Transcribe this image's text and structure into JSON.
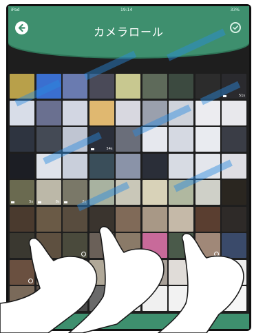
{
  "status": {
    "device": "iPad",
    "time": "19:14",
    "battery": "33%"
  },
  "header": {
    "title": "カメラロール"
  },
  "colors": {
    "accent": "#3e8f6e",
    "accent_dark": "#2f7558",
    "watermark": "#2a8be0"
  },
  "icons": {
    "back": "back-arrow-icon",
    "select": "check-circle-icon",
    "bottom": "checklist-icon"
  },
  "videos": {
    "row1_end": "51s",
    "row3_end": "54s",
    "row5_a": "5s",
    "row5_b": "8s",
    "row5_c": "2s"
  },
  "thumbnails": [
    "#b8a04a",
    "#3a6fd0",
    "#6a7bb0",
    "#4a4a58",
    "#c8c890",
    "#5e6a5a",
    "#3c4a40",
    "#2c2c2c",
    "#2a2a2e",
    "#d8dde8",
    "#6a7090",
    "#d2d6e2",
    "#e0b870",
    "#d8d8e0",
    "#9aa0ad",
    "#cfd3db",
    "#ececf0",
    "#e8e8ec",
    "#2e3440",
    "#444a55",
    "#bfc5d2",
    "#2b2f3a",
    "#6a6e7a",
    "#e6e8ee",
    "#d5d9e2",
    "#e9ebf0",
    "#3a3d46",
    "#1c1e24",
    "#dfe3ea",
    "#c9cfdb",
    "#3a4e5a",
    "#8a93a8",
    "#2a2e38",
    "#d7dbe3",
    "#e4e6ec",
    "#dedee4",
    "#6a6a50",
    "#bcb8a8",
    "#7a7868",
    "#a8b2a0",
    "#c9c7b8",
    "#d8d2b8",
    "#b0b8a0",
    "#cfd0c8",
    "#2a2620",
    "#4a3a2e",
    "#6a5a46",
    "#584c3e",
    "#3a342e",
    "#806a58",
    "#a89886",
    "#c5b9a8",
    "#5a3e30",
    "#2e2a28",
    "#3a3830",
    "#5e5040",
    "#4a4a3c",
    "#6a6058",
    "#8a7a68",
    "#c86a9a",
    "#4a5a4a",
    "#a08878",
    "#3a4a6a",
    "#6a5040",
    "#8a7a6a",
    "#9a8a7a",
    "#b0a898",
    "#c0b8a8",
    "#a8a098",
    "#e0dcd8",
    "#d8d4d0",
    "#eeeeee",
    "#7a6a5a",
    "#5a5048",
    "#4a4a4a",
    "#6a6a6a",
    "#e8e8e8",
    "#f0f0f0",
    "#f2f2f2",
    "#f4f4f4",
    "#f6f6f6"
  ]
}
